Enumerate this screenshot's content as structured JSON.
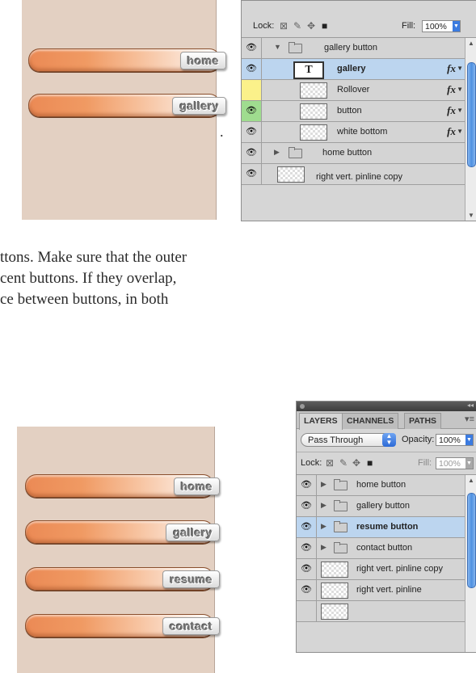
{
  "top_preview": {
    "buttons": [
      {
        "label": "home"
      },
      {
        "label": "gallery"
      }
    ]
  },
  "top_panel": {
    "lock_label": "Lock:",
    "fill_label": "Fill:",
    "fill_value": "100%",
    "layers": [
      {
        "name": "gallery button",
        "kind": "group-open",
        "eye": "normal",
        "fx": false
      },
      {
        "name": "gallery",
        "kind": "text",
        "eye": "normal",
        "fx": true,
        "selected": true,
        "bold": true
      },
      {
        "name": "Rollover",
        "kind": "pixel",
        "eye": "yellow",
        "fx": true
      },
      {
        "name": "button",
        "kind": "pixel",
        "eye": "green",
        "fx": true
      },
      {
        "name": "white bottom",
        "kind": "pixel",
        "eye": "normal",
        "fx": true
      },
      {
        "name": "home button",
        "kind": "group-closed",
        "eye": "normal",
        "fx": false
      },
      {
        "name": "right vert. pinline copy",
        "kind": "pixel",
        "eye": "normal",
        "fx": false
      }
    ],
    "text_thumb_glyph": "T",
    "fx_label": "fx"
  },
  "paragraph": {
    "dot": ".",
    "lines": [
      "ttons. Make sure that the outer",
      "cent buttons. If they overlap,",
      "ce between buttons, in both"
    ]
  },
  "bottom_preview": {
    "buttons": [
      {
        "label": "home"
      },
      {
        "label": "gallery"
      },
      {
        "label": "resume"
      },
      {
        "label": "contact"
      }
    ]
  },
  "bottom_panel": {
    "tabs": [
      "LAYERS",
      "CHANNELS",
      "PATHS"
    ],
    "active_tab": "LAYERS",
    "blend_mode": "Pass Through",
    "opacity_label": "Opacity:",
    "opacity_value": "100%",
    "lock_label": "Lock:",
    "fill_label": "Fill:",
    "fill_value": "100%",
    "layers": [
      {
        "name": "home button",
        "kind": "group-closed",
        "selected": false
      },
      {
        "name": "gallery button",
        "kind": "group-closed",
        "selected": false
      },
      {
        "name": "resume button",
        "kind": "group-closed",
        "selected": true
      },
      {
        "name": "contact button",
        "kind": "group-closed",
        "selected": false
      },
      {
        "name": "right vert. pinline copy",
        "kind": "pixel",
        "selected": false
      },
      {
        "name": "right vert. pinline",
        "kind": "pixel",
        "selected": false
      }
    ]
  },
  "icons": {
    "eye": "eye-icon",
    "folder": "folder-icon",
    "lock_transparent": "lock-transparent-pixels-icon",
    "lock_paint": "brush-icon",
    "lock_move": "move-icon",
    "lock_all": "padlock-icon"
  }
}
